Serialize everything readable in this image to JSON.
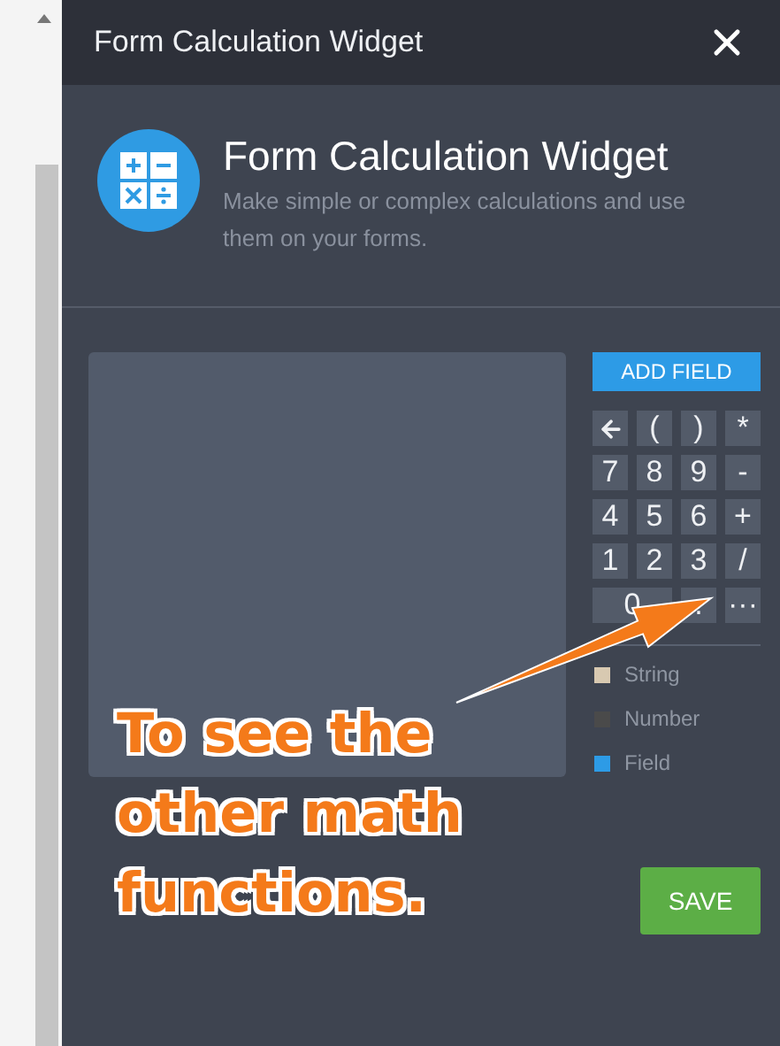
{
  "window": {
    "title": "Form Calculation Widget"
  },
  "header": {
    "title": "Form Calculation Widget",
    "description": "Make simple or complex calculations and use them on your forms."
  },
  "add_field_button": "ADD FIELD",
  "keys": [
    {
      "kind": "backspace",
      "wide": false
    },
    {
      "kind": "text",
      "label": "(",
      "wide": false
    },
    {
      "kind": "text",
      "label": ")",
      "wide": false
    },
    {
      "kind": "text",
      "label": "*",
      "wide": false
    },
    {
      "kind": "text",
      "label": "7",
      "wide": false
    },
    {
      "kind": "text",
      "label": "8",
      "wide": false
    },
    {
      "kind": "text",
      "label": "9",
      "wide": false
    },
    {
      "kind": "text",
      "label": "-",
      "wide": false
    },
    {
      "kind": "text",
      "label": "4",
      "wide": false
    },
    {
      "kind": "text",
      "label": "5",
      "wide": false
    },
    {
      "kind": "text",
      "label": "6",
      "wide": false
    },
    {
      "kind": "text",
      "label": "+",
      "wide": false
    },
    {
      "kind": "text",
      "label": "1",
      "wide": false
    },
    {
      "kind": "text",
      "label": "2",
      "wide": false
    },
    {
      "kind": "text",
      "label": "3",
      "wide": false
    },
    {
      "kind": "text",
      "label": "/",
      "wide": false
    },
    {
      "kind": "text",
      "label": "0",
      "wide": true
    },
    {
      "kind": "text",
      "label": ".",
      "wide": false
    },
    {
      "kind": "text",
      "label": "···",
      "wide": false
    }
  ],
  "legend": [
    {
      "label": "String",
      "color": "#d8c9b1"
    },
    {
      "label": "Number",
      "color": "#4a4a4a"
    },
    {
      "label": "Field",
      "color": "#2d9be6"
    }
  ],
  "save_button": "SAVE",
  "annotation": {
    "text": "To see the other math functions."
  }
}
